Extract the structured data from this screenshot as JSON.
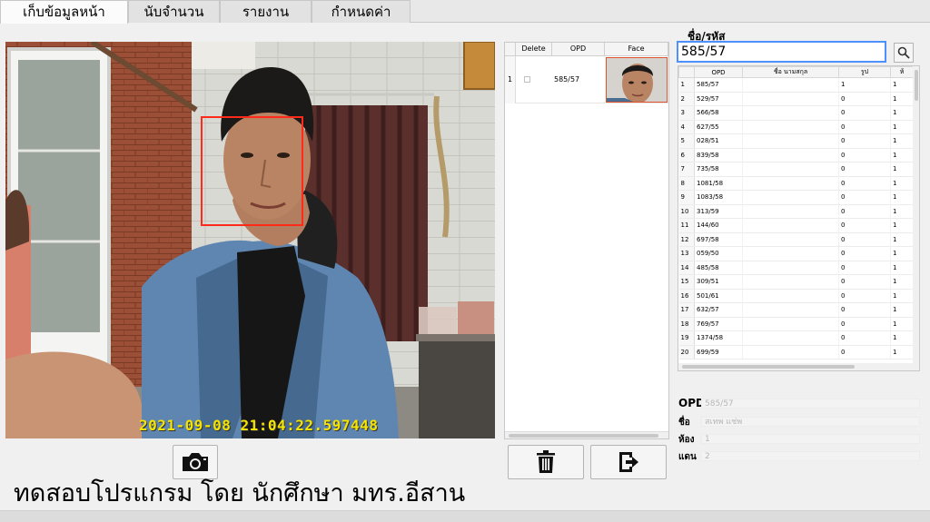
{
  "tabs": [
    {
      "label": "เก็บข้อมูลหน้า"
    },
    {
      "label": "นับจำนวน"
    },
    {
      "label": "รายงาน"
    },
    {
      "label": "กำหนดค่า"
    }
  ],
  "camera": {
    "timestamp": "2021-09-08 21:04:22.597448"
  },
  "footer": {
    "text": "ทดสอบโปรแกรม โดย นักศึกษา มทร.อีสาน"
  },
  "face_table": {
    "columns": [
      "Delete",
      "OPD",
      "Face"
    ],
    "rows": [
      {
        "index": "1",
        "opd": "585/57"
      }
    ]
  },
  "search": {
    "label": "ชื่อ/รหัส",
    "value": "585/57"
  },
  "patient_table": {
    "columns": [
      "OPD",
      "ชื่อ นามสกุล",
      "รูป",
      "ห้"
    ],
    "rows": [
      {
        "n": "1",
        "opd": "585/57",
        "photo": "1",
        "room": "1"
      },
      {
        "n": "2",
        "opd": "529/57",
        "photo": "0",
        "room": "1"
      },
      {
        "n": "3",
        "opd": "566/58",
        "photo": "0",
        "room": "1"
      },
      {
        "n": "4",
        "opd": "627/55",
        "photo": "0",
        "room": "1"
      },
      {
        "n": "5",
        "opd": "028/51",
        "photo": "0",
        "room": "1"
      },
      {
        "n": "6",
        "opd": "839/58",
        "photo": "0",
        "room": "1"
      },
      {
        "n": "7",
        "opd": "735/58",
        "photo": "0",
        "room": "1"
      },
      {
        "n": "8",
        "opd": "1081/58",
        "photo": "0",
        "room": "1"
      },
      {
        "n": "9",
        "opd": "1083/58",
        "photo": "0",
        "room": "1"
      },
      {
        "n": "10",
        "opd": "313/59",
        "photo": "0",
        "room": "1"
      },
      {
        "n": "11",
        "opd": "144/60",
        "photo": "0",
        "room": "1"
      },
      {
        "n": "12",
        "opd": "697/58",
        "photo": "0",
        "room": "1"
      },
      {
        "n": "13",
        "opd": "059/50",
        "photo": "0",
        "room": "1"
      },
      {
        "n": "14",
        "opd": "485/58",
        "photo": "0",
        "room": "1"
      },
      {
        "n": "15",
        "opd": "309/51",
        "photo": "0",
        "room": "1"
      },
      {
        "n": "16",
        "opd": "501/61",
        "photo": "0",
        "room": "1"
      },
      {
        "n": "17",
        "opd": "632/57",
        "photo": "0",
        "room": "1"
      },
      {
        "n": "18",
        "opd": "769/57",
        "photo": "0",
        "room": "1"
      },
      {
        "n": "19",
        "opd": "1374/58",
        "photo": "0",
        "room": "1"
      },
      {
        "n": "20",
        "opd": "699/59",
        "photo": "0",
        "room": "1"
      }
    ]
  },
  "info": {
    "opd_label": "OPD",
    "opd_value": "585/57",
    "name_label": "ชื่อ",
    "name_value": "สเทพ แช่พ",
    "room_label": "ห้อง",
    "room_value": "1",
    "line_label": "แดน",
    "line_value": "2"
  },
  "icons": {
    "capture": "camera-icon",
    "delete": "trash-icon",
    "export": "export-icon",
    "search": "search-icon"
  }
}
